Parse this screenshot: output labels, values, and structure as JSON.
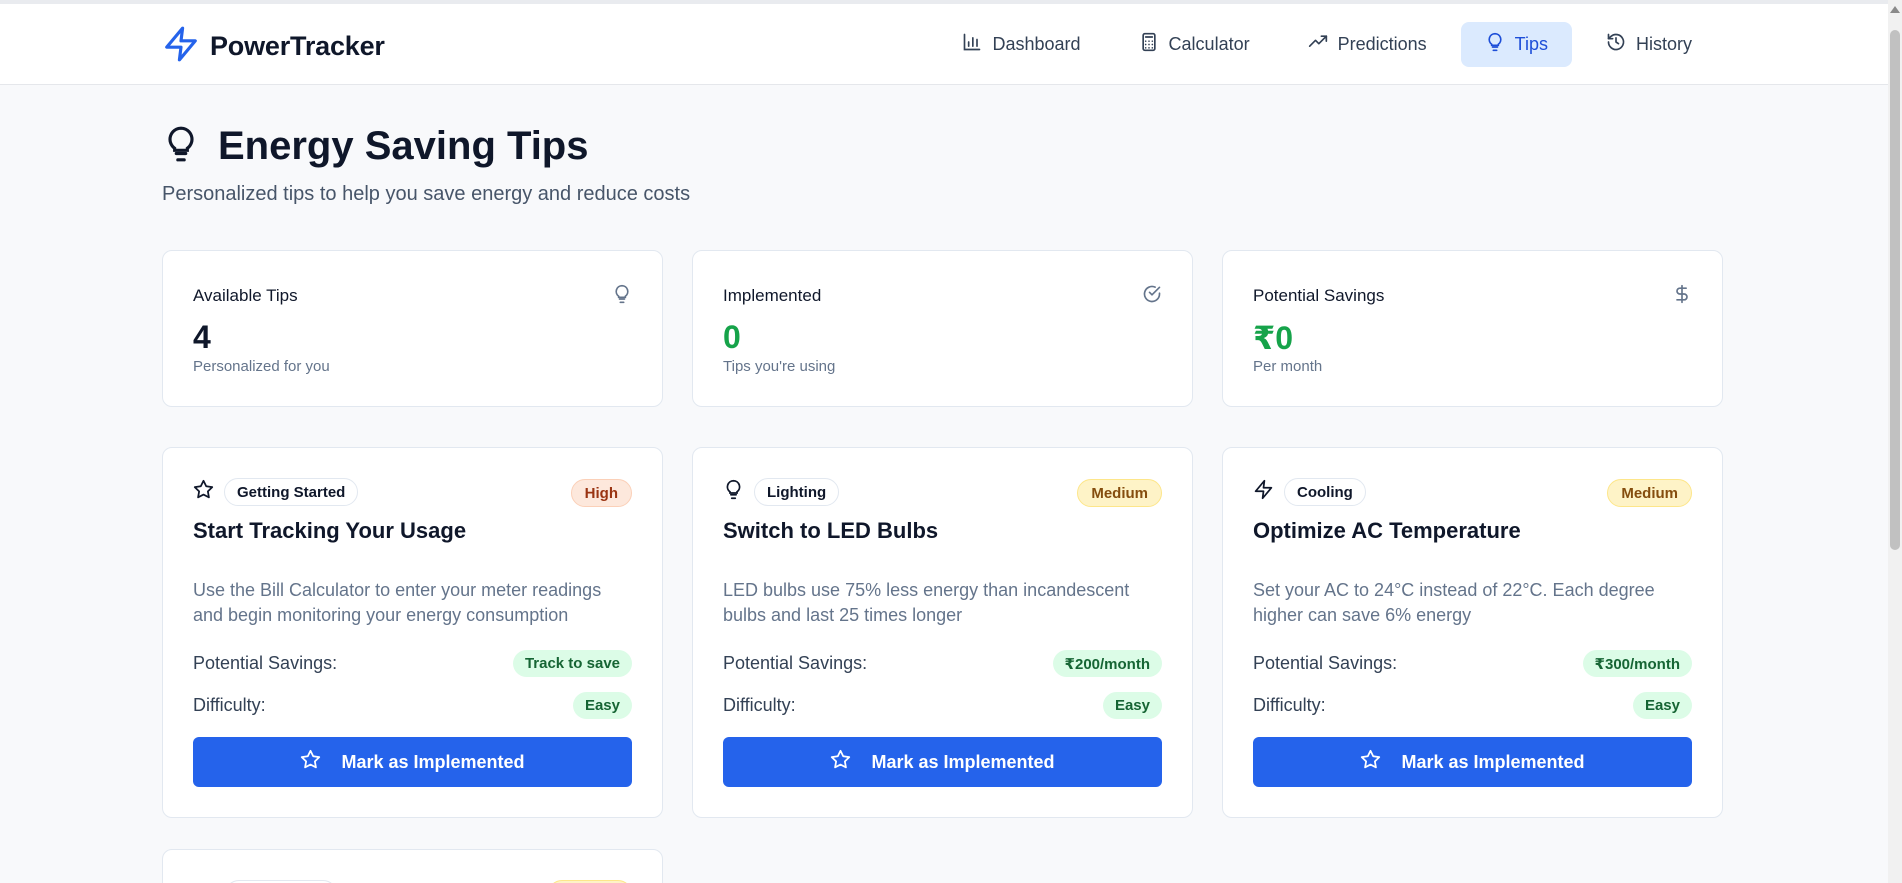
{
  "app": {
    "name": "PowerTracker"
  },
  "nav": {
    "items": [
      {
        "label": "Dashboard",
        "icon": "bar-chart-icon",
        "active": false
      },
      {
        "label": "Calculator",
        "icon": "calculator-icon",
        "active": false
      },
      {
        "label": "Predictions",
        "icon": "trending-up-icon",
        "active": false
      },
      {
        "label": "Tips",
        "icon": "lightbulb-icon",
        "active": true
      },
      {
        "label": "History",
        "icon": "history-icon",
        "active": false
      }
    ]
  },
  "page": {
    "title": "Energy Saving Tips",
    "subtitle": "Personalized tips to help you save energy and reduce costs"
  },
  "stats": [
    {
      "label": "Available Tips",
      "value": "4",
      "note": "Personalized for you",
      "icon": "lightbulb-icon",
      "value_color": "#0f172a"
    },
    {
      "label": "Implemented",
      "value": "0",
      "note": "Tips you're using",
      "icon": "check-circle-icon",
      "value_color": "#16a34a"
    },
    {
      "label": "Potential Savings",
      "value": "₹0",
      "note": "Per month",
      "icon": "dollar-icon",
      "value_color": "#16a34a"
    }
  ],
  "tips": [
    {
      "category": "Getting Started",
      "category_icon": "star-icon",
      "priority": "High",
      "title": "Start Tracking Your Usage",
      "description": "Use the Bill Calculator to enter your meter readings and begin monitoring your energy consumption",
      "savings_label": "Potential Savings:",
      "savings": "Track to save",
      "difficulty_label": "Difficulty:",
      "difficulty": "Easy",
      "button": "Mark as Implemented"
    },
    {
      "category": "Lighting",
      "category_icon": "lightbulb-icon",
      "priority": "Medium",
      "title": "Switch to LED Bulbs",
      "description": "LED bulbs use 75% less energy than incandescent bulbs and last 25 times longer",
      "savings_label": "Potential Savings:",
      "savings": "₹200/month",
      "difficulty_label": "Difficulty:",
      "difficulty": "Easy",
      "button": "Mark as Implemented"
    },
    {
      "category": "Cooling",
      "category_icon": "zap-icon",
      "priority": "Medium",
      "title": "Optimize AC Temperature",
      "description": "Set your AC to 24°C instead of 22°C. Each degree higher can save 6% energy",
      "savings_label": "Potential Savings:",
      "savings": "₹300/month",
      "difficulty_label": "Difficulty:",
      "difficulty": "Easy",
      "button": "Mark as Implemented"
    }
  ],
  "colors": {
    "primary": "#2563eb",
    "success": "#16a34a",
    "nav_active_bg": "#dbeafe",
    "priority_high_bg": "#fde8dc",
    "priority_medium_bg": "#fef3c7"
  }
}
